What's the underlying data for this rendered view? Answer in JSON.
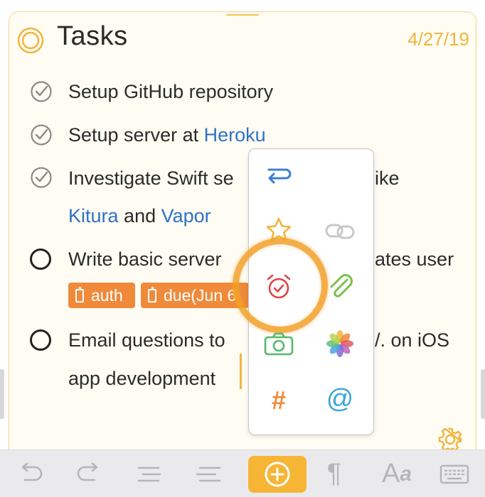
{
  "note": {
    "title": "Tasks",
    "date": "4/27/19"
  },
  "tasks": [
    {
      "done": true,
      "parts": [
        "Setup GitHub repository"
      ]
    },
    {
      "done": true,
      "parts": [
        "Setup server at ",
        "Heroku"
      ]
    },
    {
      "done": true,
      "line1": "Investigate Swift se",
      "line1_end": "ike",
      "line2_link1": "Kitura",
      "line2_mid": " and ",
      "line2_link2": "Vapor"
    },
    {
      "done": false,
      "line1": "Write basic server",
      "line1_end": "ates user",
      "tags": [
        "auth",
        "due(Jun 6"
      ]
    },
    {
      "done": false,
      "line1": "Email questions to",
      "line1_end": "/. on iOS",
      "line2": "app development"
    }
  ],
  "popover": {
    "icons": [
      "return-arrow-icon",
      "star-icon",
      "link-icon",
      "alarm-clock-icon",
      "paperclip-icon",
      "camera-icon",
      "photos-flower-icon",
      "hashtag-icon",
      "at-sign-icon"
    ],
    "hashtag": "#",
    "at": "@"
  },
  "toolbar": {
    "items": [
      "undo-icon",
      "redo-icon",
      "outdent-icon",
      "indent-icon",
      "add-button",
      "paragraph-icon",
      "text-format-icon",
      "keyboard-icon"
    ],
    "paragraph": "¶",
    "font_big": "A",
    "font_small": "a"
  },
  "colors": {
    "accent": "#f6b535",
    "tag": "#f08a3a",
    "link": "#2f72c4",
    "date": "#f0b63c"
  }
}
